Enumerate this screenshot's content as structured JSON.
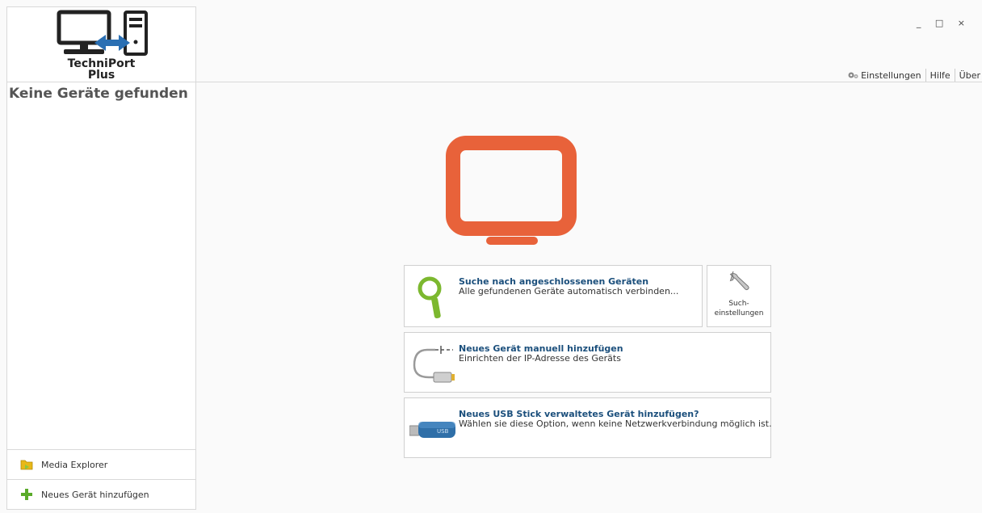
{
  "app": {
    "logo_line1": "TechniPort",
    "logo_line2": "Plus"
  },
  "window_controls": {
    "minimize": "_",
    "maximize": "□",
    "close": "×"
  },
  "top_menu": {
    "settings": "Einstellungen",
    "help": "Hilfe",
    "about": "Über"
  },
  "sidebar": {
    "status": "Keine Geräte gefunden",
    "media_explorer": "Media Explorer",
    "add_device": "Neues Gerät hinzufügen"
  },
  "actions": {
    "search": {
      "title": "Suche nach angeschlossenen Geräten",
      "desc": "Alle gefundenen Geräte automatisch verbinden..."
    },
    "search_settings": {
      "line1": "Such-",
      "line2": "einstellungen"
    },
    "manual": {
      "title": "Neues Gerät manuell hinzufügen",
      "desc": "Einrichten der IP-Adresse des Geräts"
    },
    "usb": {
      "title": "Neues USB Stick verwaltetes Gerät hinzufügen?",
      "desc": "Wählen sie diese Option, wenn keine Netzwerkverbindung möglich ist.",
      "stick_label": "USB"
    }
  },
  "colors": {
    "accent_orange": "#e8623a",
    "title_blue": "#1b4f7c",
    "magnifier_green": "#7cb82f"
  }
}
